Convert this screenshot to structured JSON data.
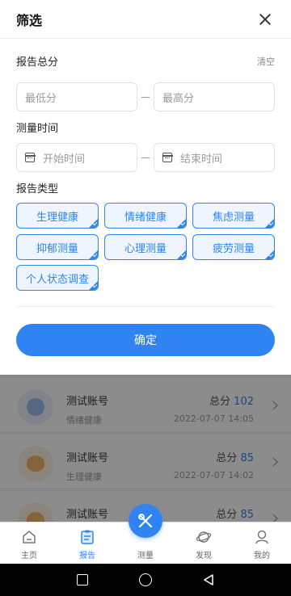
{
  "header": {
    "title": "筛选",
    "close_icon": "close-icon"
  },
  "score": {
    "label": "报告总分",
    "clear_label": "清空",
    "min_placeholder": "最低分",
    "max_placeholder": "最高分"
  },
  "time": {
    "label": "测量时间",
    "start_placeholder": "开始时间",
    "end_placeholder": "结束时间",
    "icon": "calendar-icon"
  },
  "types": {
    "label": "报告类型",
    "chips": [
      "生理健康",
      "情绪健康",
      "焦虑测量",
      "抑郁测量",
      "心理测量",
      "疲劳测量",
      "个人状态调查"
    ]
  },
  "confirm_label": "确定",
  "list": {
    "items": [
      {
        "name": "测试账号",
        "type": "情绪健康",
        "score_label": "总分",
        "score": "102",
        "date": "2022-07-07 14:05"
      },
      {
        "name": "测试账号",
        "type": "生理健康",
        "score_label": "总分",
        "score": "85",
        "date": "2022-07-07 14:02"
      },
      {
        "name": "测试账号",
        "score_label": "总分",
        "score": "85"
      }
    ]
  },
  "tabbar": {
    "tabs": [
      {
        "label": "主页",
        "icon": "home-icon"
      },
      {
        "label": "报告",
        "icon": "report-icon",
        "active": true
      },
      {
        "label": "测量",
        "icon": "measure-icon"
      },
      {
        "label": "发现",
        "icon": "discover-icon"
      },
      {
        "label": "我的",
        "icon": "profile-icon"
      }
    ]
  },
  "colors": {
    "accent": "#2f84f2",
    "chip_bg": "#eef5ff"
  }
}
